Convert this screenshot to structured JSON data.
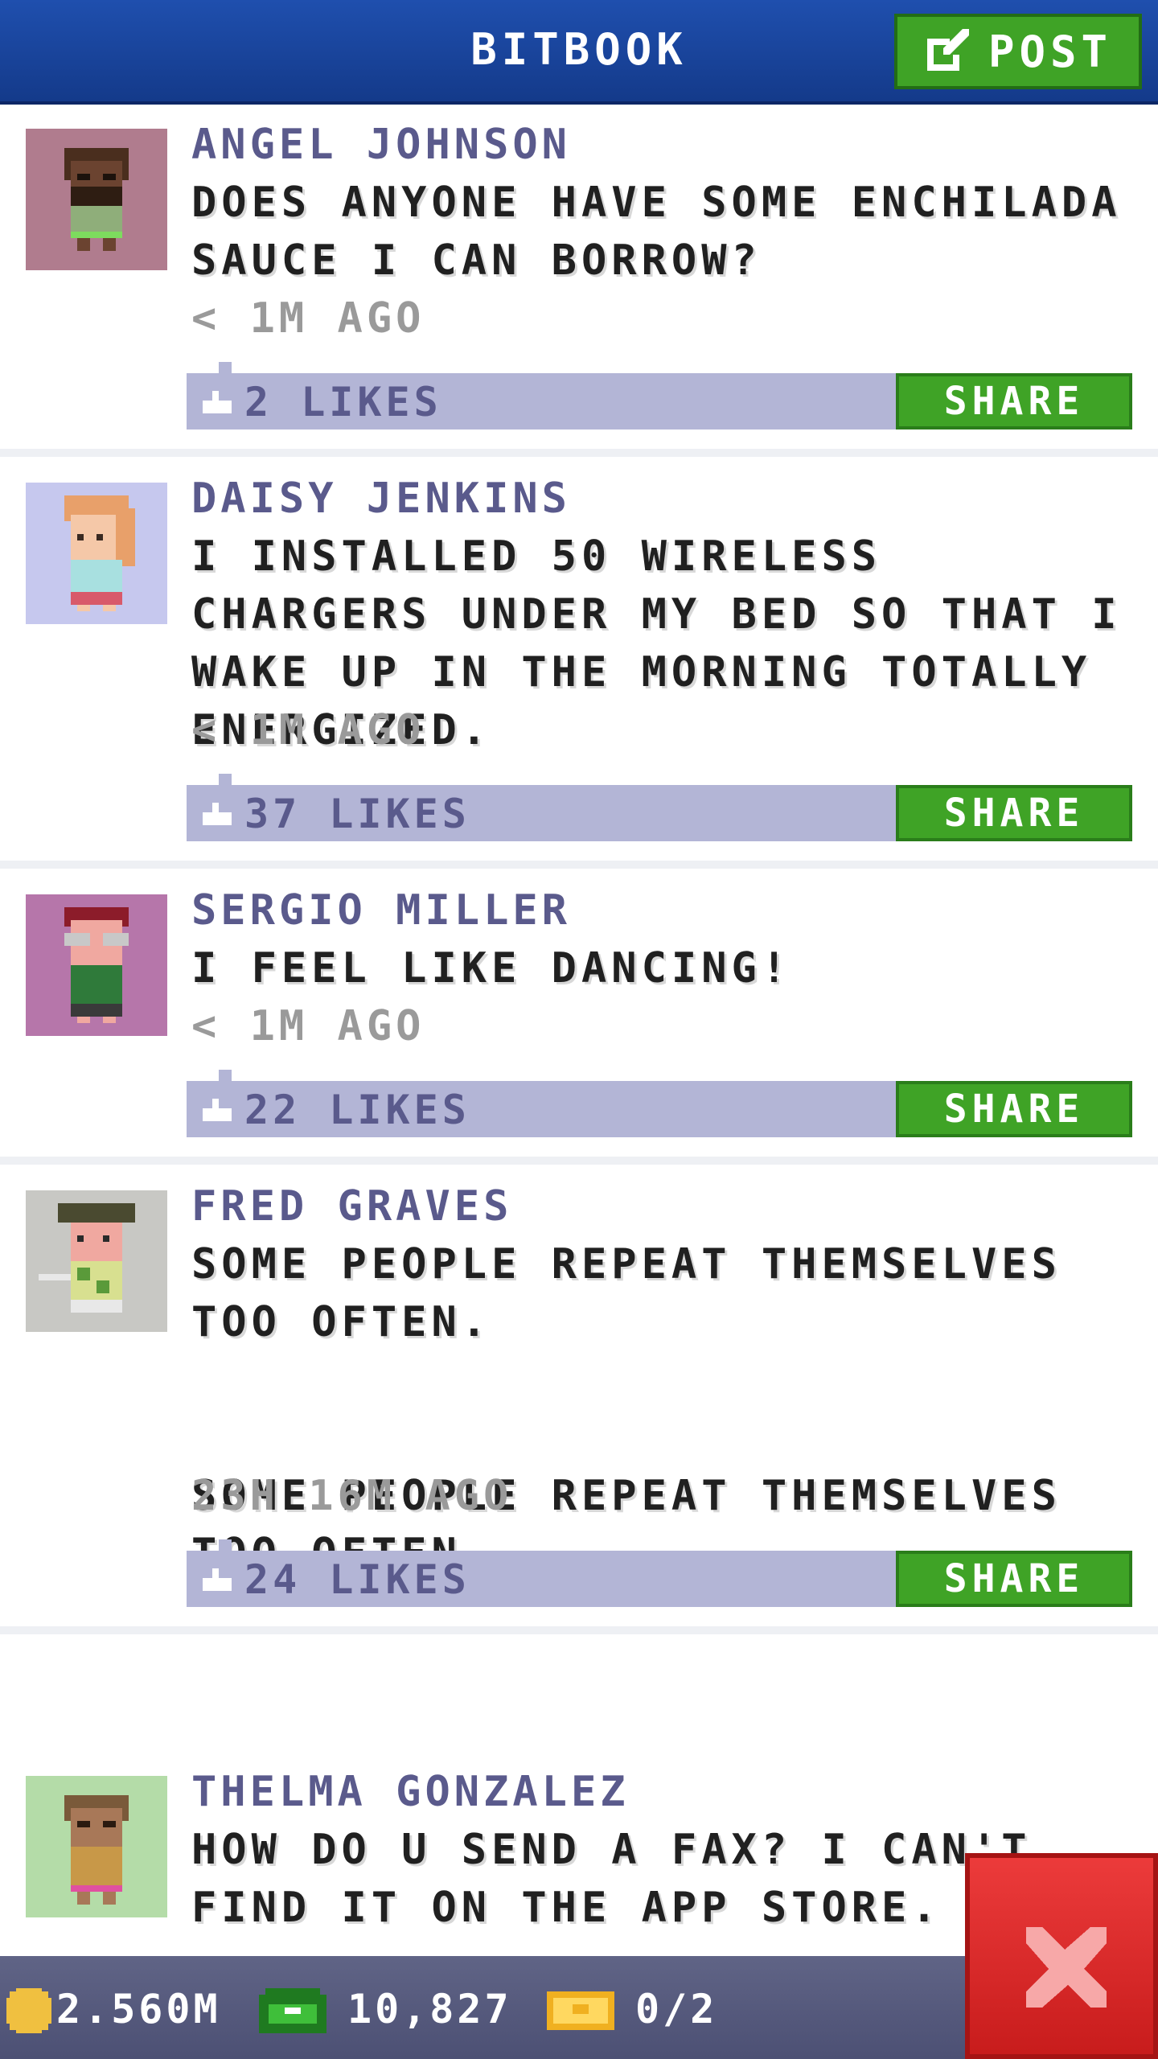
{
  "header": {
    "title": "BITBOOK",
    "post_label": "POST",
    "post_icon": "edit-icon"
  },
  "posts": [
    {
      "author": "ANGEL JOHNSON",
      "message": "DOES ANYONE HAVE SOME ENCHILADA SAUCE I CAN BORROW?",
      "time": "< 1M AGO",
      "likes": "2 LIKES",
      "share": "SHARE"
    },
    {
      "author": "DAISY JENKINS",
      "message": "I INSTALLED 50 WIRELESS CHARGERS UNDER MY BED SO THAT I WAKE UP IN THE MORNING TOTALLY ENERGIZED.",
      "time": "< 1M AGO",
      "likes": "37 LIKES",
      "share": "SHARE"
    },
    {
      "author": "SERGIO MILLER",
      "message": "I FEEL LIKE DANCING!",
      "time": "< 1M AGO",
      "likes": "22 LIKES",
      "share": "SHARE"
    },
    {
      "author": "FRED GRAVES",
      "message": "SOME PEOPLE REPEAT THEMSELVES TOO OFTEN.\n\n\nSOME PEOPLE REPEAT THEMSELVES TOO OFTEN.",
      "time": "23H 16M AGO",
      "likes": "24 LIKES",
      "share": "SHARE"
    },
    {
      "author": "THELMA GONZALEZ",
      "message": "HOW DO U SEND A FAX? I CAN'T FIND IT ON THE APP STORE.",
      "time": "",
      "likes": "",
      "share": ""
    }
  ],
  "footer": {
    "coins": "2.560M",
    "bux": "10,827",
    "tickets": "0/2"
  },
  "colors": {
    "header": "#1f4fae",
    "accent_green": "#3fa326",
    "like_bar": "#b3b5d6",
    "name": "#5a5a8c",
    "close_red": "#e03030"
  }
}
